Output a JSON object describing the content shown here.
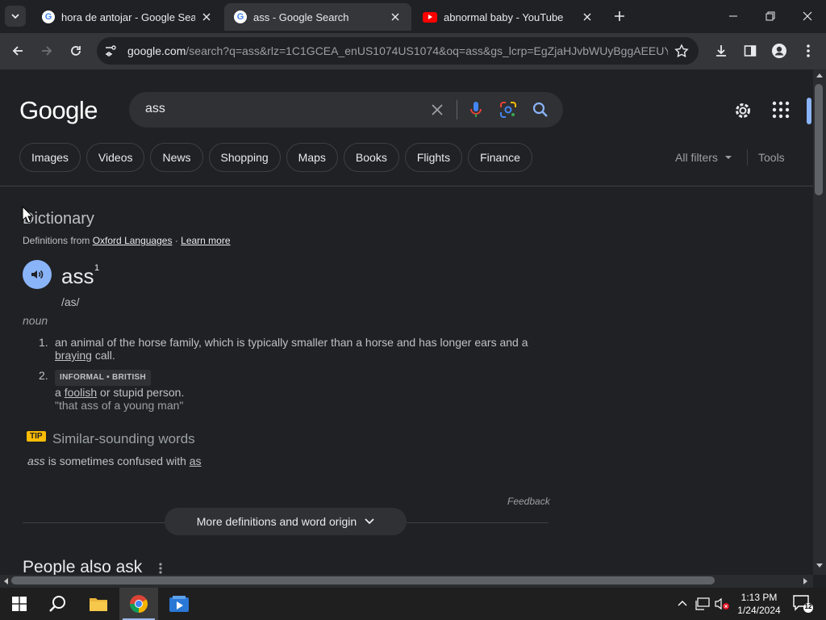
{
  "browser": {
    "tabs": [
      {
        "title": "hora de antojar - Google Search",
        "favicon": "google-g-icon",
        "active": false
      },
      {
        "title": "ass - Google Search",
        "favicon": "google-g-icon",
        "active": true
      },
      {
        "title": "abnormal baby - YouTube",
        "favicon": "youtube-icon",
        "active": false
      }
    ],
    "url_host": "google.com",
    "url_path": "/search?q=ass&rlz=1C1GCEA_enUS1074US1074&oq=ass&gs_lcrp=EgZjaHJvbWUyBggAEEUYO..."
  },
  "google": {
    "logo": "Google",
    "query": "ass",
    "chips": [
      "Images",
      "Videos",
      "News",
      "Shopping",
      "Maps",
      "Books",
      "Flights",
      "Finance"
    ],
    "all_filters": "All filters",
    "tools": "Tools"
  },
  "dictionary": {
    "heading": "Dictionary",
    "defs_from": "Definitions from",
    "source": "Oxford Languages",
    "separator": "·",
    "learn_more": "Learn more",
    "word": "ass",
    "superscript": "1",
    "phonetic": "/as/",
    "part_of_speech": "noun",
    "definitions": [
      {
        "num": "1.",
        "text_before": "an animal of the horse family, which is typically smaller than a horse and has longer ears and a",
        "link": "braying",
        "text_after": "call."
      },
      {
        "num": "2.",
        "label": "INFORMAL • BRITISH",
        "text_before": "a",
        "link": "foolish",
        "text_after": "or stupid person.",
        "example": "\"that ass of a young man\""
      }
    ],
    "tip_badge": "TIP",
    "similar_title": "Similar-sounding words",
    "confused_word": "ass",
    "confused_text": "is sometimes confused with",
    "confused_link": "as",
    "feedback": "Feedback",
    "more_button": "More definitions and word origin"
  },
  "people_also_ask": "People also ask",
  "taskbar": {
    "time": "1:13 PM",
    "date": "1/24/2024",
    "notif_count": "12"
  }
}
